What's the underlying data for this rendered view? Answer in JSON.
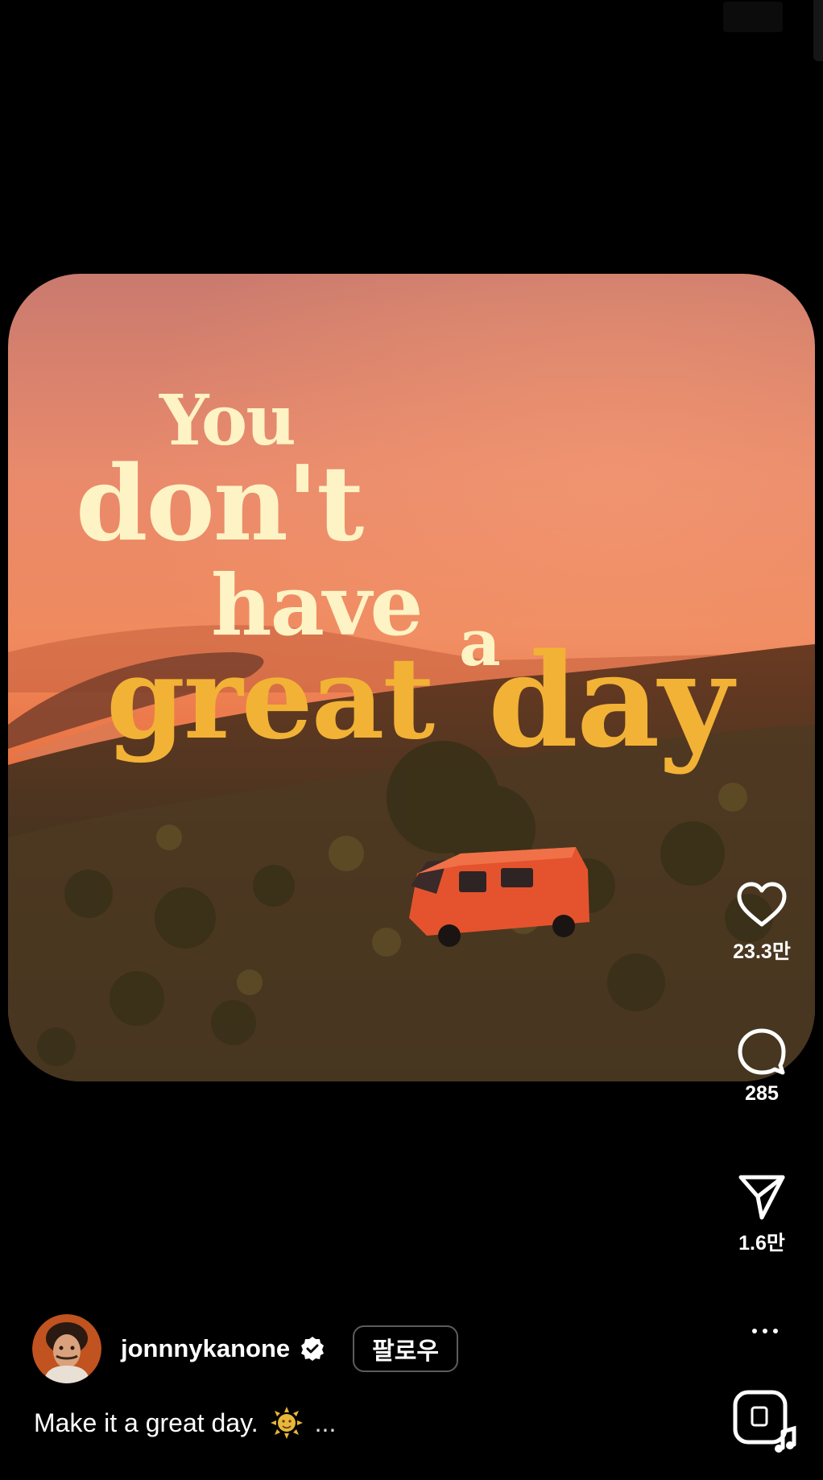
{
  "post": {
    "headline": {
      "line1": "You",
      "line2": "don't",
      "line3": "have",
      "line3b": "a",
      "line4": "great",
      "line4b": "day"
    },
    "author": {
      "username": "jonnnykanone",
      "follow_label": "팔로우"
    },
    "caption": {
      "text": "Make it a great day.",
      "emoji": "sun-emoji",
      "more": "..."
    }
  },
  "actions": {
    "likes": "23.3만",
    "comments": "285",
    "shares": "1.6만"
  },
  "colors": {
    "headline_light": "#fdf3c4",
    "headline_accent": "#f2b235",
    "background": "#000000"
  }
}
